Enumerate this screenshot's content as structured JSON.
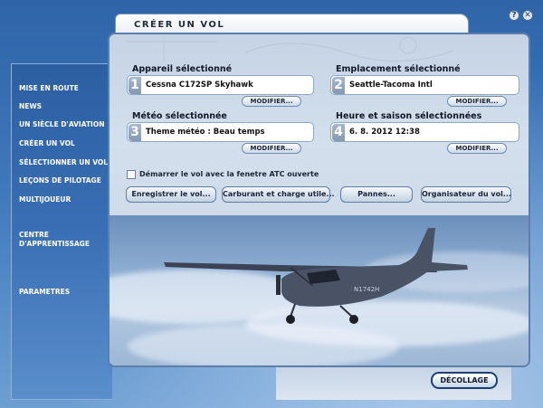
{
  "window": {
    "title": "CRÉER UN VOL",
    "help_glyph": "?",
    "close_glyph": "✕"
  },
  "sidebar": {
    "items": [
      {
        "label": "MISE EN ROUTE"
      },
      {
        "label": "NEWS"
      },
      {
        "label": "UN SIÈCLE D'AVIATION"
      },
      {
        "label": "CRÉER UN VOL"
      },
      {
        "label": "SÉLECTIONNER UN VOL"
      },
      {
        "label": "LEÇONS DE PILOTAGE"
      },
      {
        "label": "MULTIJOUEUR"
      },
      {
        "label": "CENTRE D'APPRENTISSAGE"
      },
      {
        "label": "PARAMETRES"
      }
    ]
  },
  "sections": [
    {
      "label": "Appareil sélectionné",
      "number": "1",
      "value": "Cessna C172SP Skyhawk",
      "button": "MODIFIER..."
    },
    {
      "label": "Emplacement sélectionné",
      "number": "2",
      "value": "Seattle-Tacoma Intl",
      "button": "MODIFIER..."
    },
    {
      "label": "Météo sélectionnée",
      "number": "3",
      "value": "Theme météo : Beau temps",
      "button": "MODIFIER..."
    },
    {
      "label": "Heure et saison sélectionnées",
      "number": "4",
      "value": "6. 8. 2012 12:38",
      "button": "MODIFIER..."
    }
  ],
  "atc_checkbox": {
    "label": "Démarrer le vol avec la fenetre ATC ouverte",
    "checked": false
  },
  "actions": {
    "save": "Enregistrer le vol...",
    "fuel": "Carburant et charge utile...",
    "failures": "Pannes...",
    "planner": "Organisateur du vol..."
  },
  "aircraft_registration": "N1742H",
  "takeoff_button": "DÉCOLLAGE",
  "colors": {
    "background": "#3d78bd",
    "panel": "#c9d6e6",
    "accent_border": "#1f3f74"
  }
}
